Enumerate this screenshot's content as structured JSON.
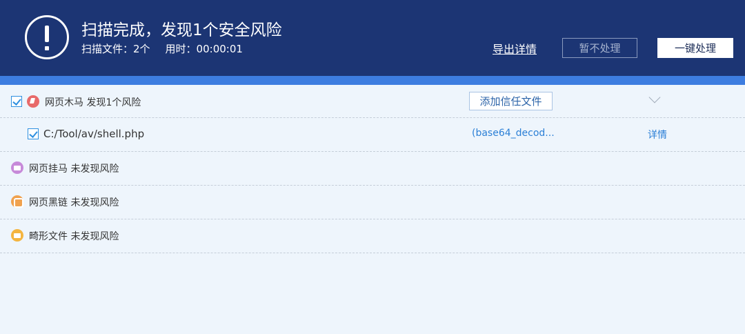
{
  "header": {
    "title": "扫描完成，发现1个安全风险",
    "scanned_label": "扫描文件：2个",
    "time_label": "用时：00:00:01",
    "export_link": "导出详情",
    "ignore_button": "暂不处理",
    "fix_button": "一键处理",
    "icon": "exclamation-circle-icon"
  },
  "categories": [
    {
      "icon": "trojan-icon",
      "label": "网页木马 发现1个风险",
      "checked": true,
      "trust_button": "添加信任文件",
      "expanded": true,
      "files": [
        {
          "checked": true,
          "path": "C:/Tool/av/shell.php",
          "signature": "(base64_decod...",
          "detail_link": "详情"
        }
      ]
    },
    {
      "icon": "web-hang-icon",
      "label": "网页挂马 未发现风险"
    },
    {
      "icon": "black-link-icon",
      "label": "网页黑链 未发现风险"
    },
    {
      "icon": "malformed-file-icon",
      "label": "畸形文件 未发现风险"
    }
  ],
  "colors": {
    "header_bg": "#1c3574",
    "accent_strip": "#3d7de0",
    "link": "#2b7fd6",
    "body_bg": "#eef5fc"
  }
}
